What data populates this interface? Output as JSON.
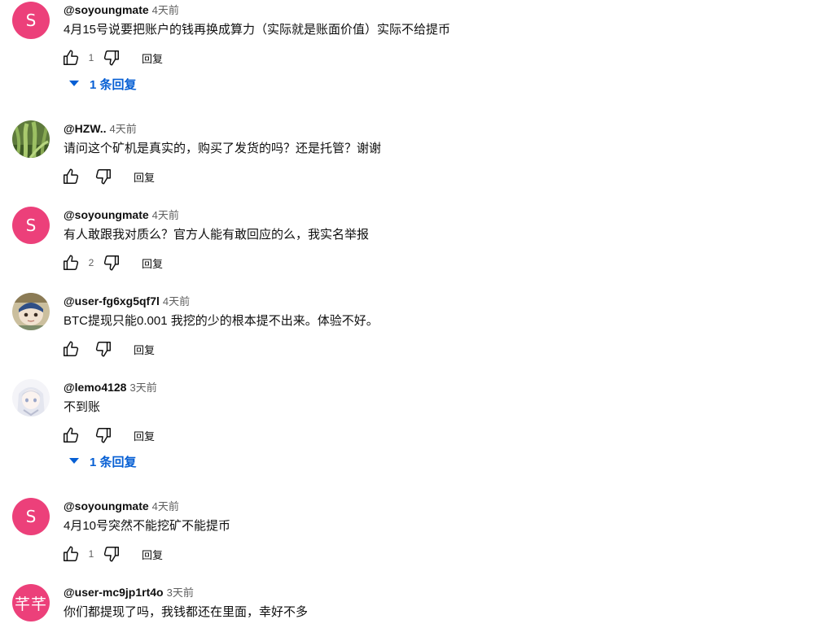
{
  "comments": [
    {
      "author": "@soyoungmate",
      "time": "4天前",
      "avatar_letter": "S",
      "text": "4月15号说要把账户的钱再换成算力（实际就是账面价值）实际不给提币",
      "likes": "1",
      "reply_label": "回复",
      "replies_label": "1 条回复"
    },
    {
      "author": "@HZW..",
      "time": "4天前",
      "text": "请问这个矿机是真实的，购买了发货的吗？还是托管？谢谢",
      "likes": "",
      "reply_label": "回复"
    },
    {
      "author": "@soyoungmate",
      "time": "4天前",
      "avatar_letter": "S",
      "text": "有人敢跟我对质么？官方人能有敢回应的么，我实名举报",
      "likes": "2",
      "reply_label": "回复"
    },
    {
      "author": "@user-fg6xg5qf7l",
      "time": "4天前",
      "text": "BTC提现只能0.001 我挖的少的根本提不出来。体验不好。",
      "likes": "",
      "reply_label": "回复"
    },
    {
      "author": "@lemo4128",
      "time": "3天前",
      "text": "不到账",
      "likes": "",
      "reply_label": "回复",
      "replies_label": "1 条回复"
    },
    {
      "author": "@soyoungmate",
      "time": "4天前",
      "avatar_letter": "S",
      "text": "4月10号突然不能挖矿不能提币",
      "likes": "1",
      "reply_label": "回复"
    },
    {
      "author": "@user-mc9jp1rt4o",
      "time": "3天前",
      "avatar_letter": "芊芊",
      "text": "你们都提现了吗，我钱都还在里面，幸好不多"
    }
  ],
  "colors": {
    "avatar_pink": "#ec407a",
    "link_blue": "#065fd4",
    "secondary_text": "#606060"
  },
  "icons": {
    "like": "thumbs-up-icon",
    "dislike": "thumbs-down-icon",
    "expand": "caret-down-icon"
  }
}
